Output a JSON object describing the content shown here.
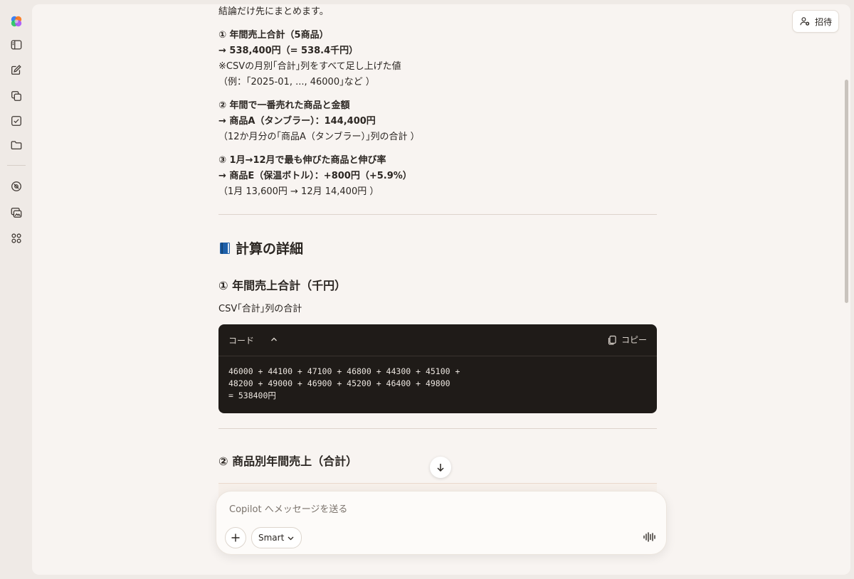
{
  "header": {
    "invite_label": "招待"
  },
  "sidebar": {
    "items": [
      {
        "name": "copilot-logo"
      },
      {
        "name": "sidebar-toggle-icon"
      },
      {
        "name": "new-chat-icon"
      },
      {
        "name": "library-icon"
      },
      {
        "name": "tasks-icon"
      },
      {
        "name": "folder-icon"
      },
      {
        "name": "discover-icon"
      },
      {
        "name": "image-gallery-icon"
      },
      {
        "name": "apps-icon"
      }
    ]
  },
  "message": {
    "intro": "結論だけ先にまとめます。",
    "summary": [
      {
        "heading": "① 年間売上合計（5商品）",
        "answer": "→ 538,400円（= 538.4千円）",
        "notes": [
          "※CSVの月別｢合計｣列をすべて足し上げた値",
          "（例：｢2025-01, ..., 46000｣など ）"
        ]
      },
      {
        "heading": "② 年間で一番売れた商品と金額",
        "answer": "→ 商品A（タンブラー）：144,400円",
        "notes": [
          "（12か月分の｢商品A（タンブラー）｣列の合計 ）"
        ]
      },
      {
        "heading": "③ 1月→12月で最も伸びた商品と伸び率",
        "answer": "→ 商品E（保温ボトル）：+800円（+5.9%）",
        "notes": [
          "（1月 13,600円 → 12月 14,400円 ）"
        ]
      }
    ],
    "details_title": "計算の詳細",
    "section1_title": "① 年間売上合計（千円）",
    "section1_desc": "CSV｢合計｣列の合計",
    "code": {
      "lang_label": "コード",
      "copy_label": "コピー",
      "lines": [
        "46000 + 44100 + 47100 + 46800 + 44300 + 45100 +",
        "48200 + 49000 + 46900 + 45200 + 46400 + 49800",
        "= 538400円"
      ]
    },
    "section2_title": "② 商品別年間売上（合計）"
  },
  "composer": {
    "placeholder": "Copilot へメッセージを送る",
    "mode_label": "Smart"
  }
}
